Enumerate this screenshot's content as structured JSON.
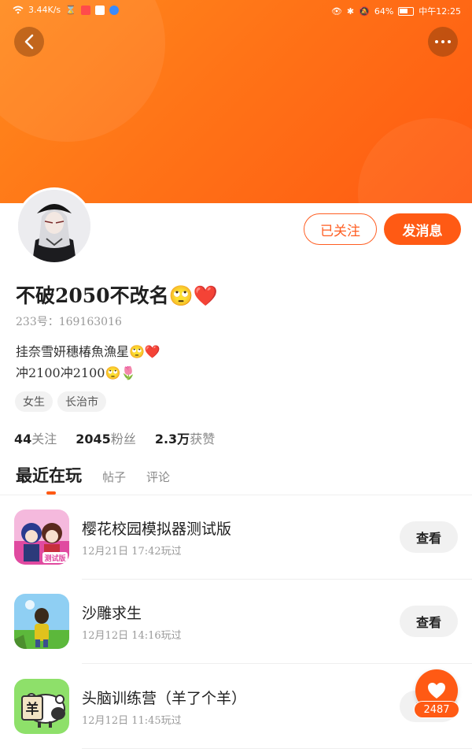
{
  "status_bar": {
    "net_speed": "3.44K/s",
    "battery": "64%",
    "time": "中午12:25"
  },
  "header": {
    "back_icon": "chevron-left-icon",
    "more_icon": "more-dots-icon"
  },
  "profile": {
    "username": "不破2050不改名🙄❤️",
    "id_line": "233号：169163016",
    "bio_line1": "挂奈雪妍穗椿魚漁星🙄❤️",
    "bio_line2": "冲2100冲2100🙄🌷",
    "tags": [
      "女生",
      "长治市"
    ],
    "stats": {
      "following_count": "44",
      "following_label": "关注",
      "followers_count": "2045",
      "followers_label": "粉丝",
      "likes_count": "2.3万",
      "likes_label": "获赞"
    }
  },
  "actions": {
    "followed_label": "已关注",
    "message_label": "发消息"
  },
  "tabs": [
    "最近在玩",
    "帖子",
    "评论"
  ],
  "games": [
    {
      "title": "樱花校园模拟器测试版",
      "meta": "12月21日 17:42玩过",
      "button": "查看"
    },
    {
      "title": "沙雕求生",
      "meta": "12月12日 14:16玩过",
      "button": "查看"
    },
    {
      "title": "头脑训练营（羊了个羊）",
      "meta": "12月12日 11:45玩过",
      "button": "查看"
    }
  ],
  "game_icon_texts": {
    "g1_badge": "测试版",
    "g3_char": "羊"
  },
  "floating": {
    "like_count": "2487"
  },
  "colors": {
    "accent": "#ff5a14",
    "banner": "#ff7a18"
  }
}
